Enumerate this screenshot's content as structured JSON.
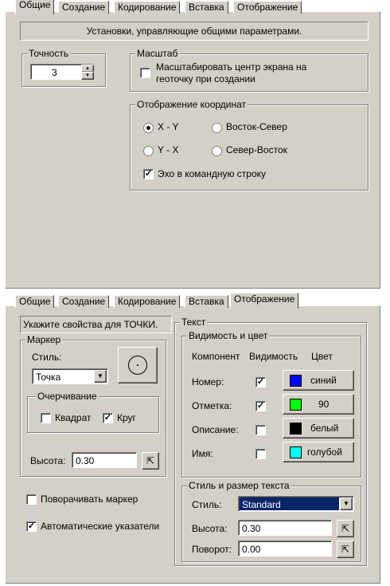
{
  "tabs": [
    "Общие",
    "Создание",
    "Кодирование",
    "Вставка",
    "Отображение"
  ],
  "top": {
    "description": "Установки, управляющие общими параметрами.",
    "precision": {
      "label": "Точность",
      "value": "3"
    },
    "scale": {
      "label": "Масштаб",
      "checkbox_label": "Масштабировать центр экрана на геоточку при создании",
      "checked": false
    },
    "coords": {
      "label": "Отображение координат",
      "options": [
        "X - Y",
        "Восток-Север",
        "Y - X",
        "Север-Восток"
      ],
      "selected": "X - Y",
      "echo_label": "Эхо в командную строку",
      "echo_checked": true
    }
  },
  "bottom": {
    "description": "Укажите свойства для ТОЧКИ.",
    "marker": {
      "label": "Маркер",
      "style_label": "Стиль:",
      "style_value": "Точка",
      "outline_label": "Очерчивание",
      "square_label": "Квадрат",
      "square_checked": false,
      "circle_label": "Круг",
      "circle_checked": true,
      "height_label": "Высота:",
      "height_value": "0.30"
    },
    "rotate_label": "Поворачивать маркер",
    "rotate_checked": false,
    "auto_label": "Автоматические указатели",
    "auto_checked": true,
    "text": {
      "label": "Текст",
      "visibility": {
        "label": "Видимость и цвет",
        "headers": {
          "component": "Компонент",
          "visibility": "Видимость",
          "color": "Цвет"
        },
        "rows": [
          {
            "name": "Номер:",
            "visible": true,
            "color_name": "синий",
            "color": "#0000ff"
          },
          {
            "name": "Отметка:",
            "visible": true,
            "color_name": "90",
            "color": "#00ff00"
          },
          {
            "name": "Описание:",
            "visible": false,
            "color_name": "белый",
            "color": "#000000"
          },
          {
            "name": "Имя:",
            "visible": false,
            "color_name": "голубой",
            "color": "#00ffff"
          }
        ]
      },
      "style": {
        "label": "Стиль и размер текста",
        "style_label": "Стиль:",
        "style_value": "Standard",
        "height_label": "Высота:",
        "height_value": "0.30",
        "rotation_label": "Поворот:",
        "rotation_value": "0.00"
      }
    }
  }
}
